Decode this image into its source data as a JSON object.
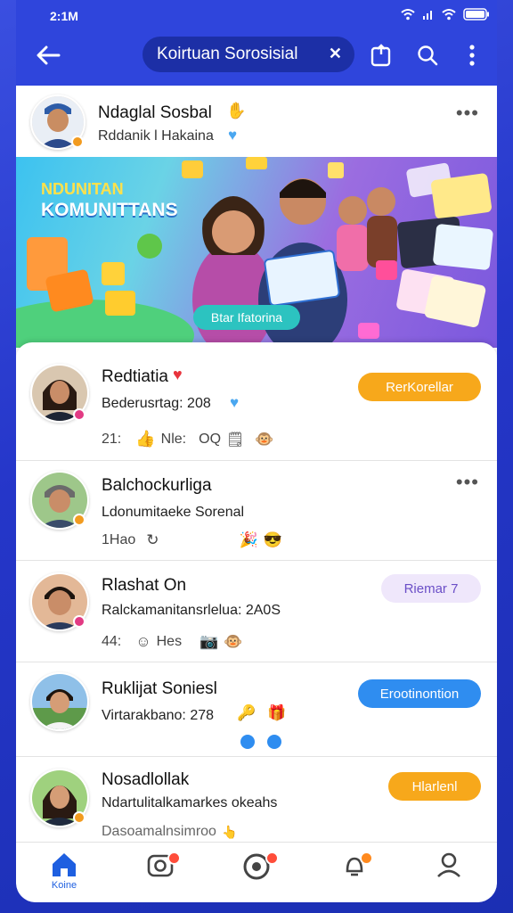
{
  "status_bar": {
    "time": "2:1M"
  },
  "app_bar": {
    "title": "Koirtuan Sorosisial",
    "close_symbol": "✕"
  },
  "profile": {
    "name": "Ndaglal Sosbal",
    "subtitle": "Rddanik l Hakaina",
    "more": "•••"
  },
  "banner": {
    "title_line1": "NDUNITAN",
    "title_line2": "KOMUNITTANS",
    "button_label": "Btar Ifatorina"
  },
  "posts": [
    {
      "name": "Redtiatia",
      "text": "Bederusrtag: 208",
      "meta_count": "21:",
      "meta_like": "Nle:",
      "meta_comment": "OQ",
      "pill_label": "RerKorellar",
      "pill_color": "#f7a81b",
      "dot_color": "#e23a83"
    },
    {
      "name": "Balchockurliga",
      "text": "Ldonumitaeke Sorenal",
      "meta_count": "1Hao",
      "more": "•••",
      "dot_color": "#f29b1f"
    },
    {
      "name": "Rlashat On",
      "text": "Ralckamanitansrlelua: 2A0S",
      "meta_count": "44:",
      "meta_like": "Hes",
      "pill_label": "Riemar 7",
      "pill_color": "#efe7fb",
      "dot_color": "#e23a83"
    },
    {
      "name": "Ruklijat Soniesl",
      "text": "Virtarakbano: 278",
      "pill_label": "Erootinontion",
      "pill_color": "#2f8df0",
      "dot_color": "#e23a83"
    },
    {
      "name": "Nosadlollak",
      "text": "Ndartulitalkamarkes okeahs",
      "meta_count": "Dasoamalnsimroo",
      "pill_label": "Hlarlenl",
      "pill_color": "#f7a81b",
      "dot_color": "#f29b1f"
    }
  ],
  "bottom_nav": {
    "home_label": "Koine",
    "icons": [
      "home-icon",
      "camera-icon",
      "record-icon",
      "notification-icon",
      "profile-icon"
    ]
  },
  "colors": {
    "accent": "#2f45dc",
    "header_pill": "#1c2fa6",
    "nav_active": "#1e5fe0"
  }
}
